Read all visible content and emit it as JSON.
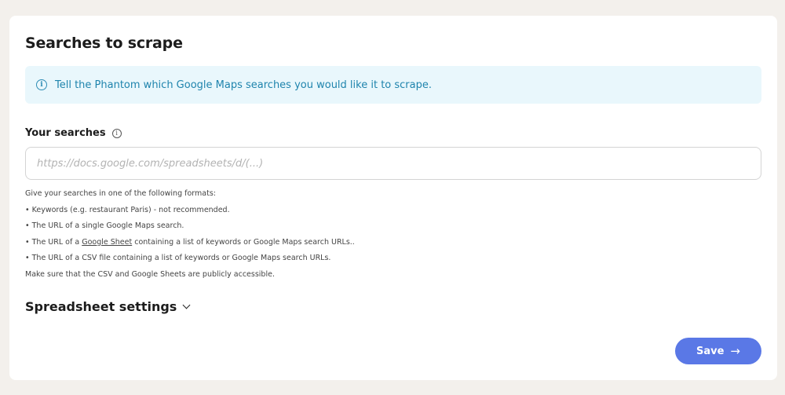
{
  "section": {
    "title": "Searches to scrape",
    "info_icon": "info-circle-icon",
    "info_text": "Tell the Phantom which Google Maps searches you would like it to scrape."
  },
  "searches": {
    "label": "Your searches",
    "label_icon": "info-circle-icon",
    "placeholder": "https://docs.google.com/spreadsheets/d/(...)",
    "value": ""
  },
  "help": {
    "intro": "Give your searches in one of the following formats:",
    "item1": "• Keywords (e.g. restaurant Paris) - not recommended.",
    "item2": "• The URL of a single Google Maps search.",
    "item3_prefix": "• The URL of a ",
    "item3_link": "Google Sheet",
    "item3_suffix": " containing a list of keywords or Google Maps search URLs..",
    "item4": "• The URL of a CSV file containing a list of keywords or Google Maps search URLs.",
    "note": "Make sure that the CSV and Google Sheets are publicly accessible."
  },
  "spreadsheet_settings": {
    "label": "Spreadsheet settings",
    "icon": "chevron-down-icon"
  },
  "actions": {
    "save_label": "Save",
    "save_icon": "arrow-right-icon"
  },
  "colors": {
    "page_bg": "#f3f0ec",
    "info_bg": "#e9f7fc",
    "info_text": "#1f84ad",
    "accent": "#5a78e6"
  }
}
